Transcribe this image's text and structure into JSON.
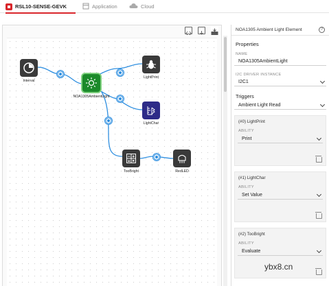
{
  "tabs": [
    {
      "label": "RSL10-SENSE-GEVK",
      "icon": "chip-icon",
      "active": true
    },
    {
      "label": "Application",
      "icon": "application-icon",
      "active": false
    },
    {
      "label": "Cloud",
      "icon": "cloud-icon",
      "active": false
    }
  ],
  "canvas": {
    "toolbar": [
      "code-view-icon",
      "export-icon",
      "deploy-icon"
    ],
    "nodes": {
      "interval": "Interval",
      "ambient": "NOA1305AmbientLight",
      "lightprint": "LightPrint",
      "lightchar": "LightChar",
      "toobright": "TooBright",
      "redled": "RedLED"
    }
  },
  "panel": {
    "title": "NOA1305 Ambient Light Element",
    "help": "?",
    "properties_title": "Properties",
    "name_label": "NAME",
    "name_value": "NOA1305AmbientLight",
    "i2c_label": "I2C DRIVER INSTANCE",
    "i2c_value": "I2C1",
    "triggers_title": "Triggers",
    "trigger_value": "Ambient Light Read",
    "cards": [
      {
        "title": "(#0) LightPrint",
        "ability_label": "ABILITY",
        "ability_value": "Print"
      },
      {
        "title": "(#1) LightChar",
        "ability_label": "ABILITY",
        "ability_value": "Set Value"
      },
      {
        "title": "(#2) TooBright",
        "ability_label": "ABILITY",
        "ability_value": "Evaluate"
      }
    ]
  },
  "watermark": "ybx8.cn",
  "colors": {
    "accent": "#d9262b",
    "link": "#2f8fe0",
    "node_dark": "#3a3a3a",
    "node_green": "#1b8a2a",
    "node_blue": "#2d2b88"
  }
}
